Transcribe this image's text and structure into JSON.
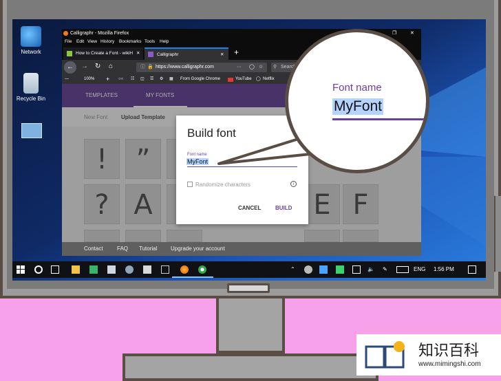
{
  "desktop": {
    "icons": [
      {
        "label": "Network"
      },
      {
        "label": "Recycle Bin"
      }
    ]
  },
  "firefox": {
    "window_title": "Calligraphr - Mozilla Firefox",
    "menu": [
      "File",
      "Edit",
      "View",
      "History",
      "Bookmarks",
      "Tools",
      "Help"
    ],
    "tabs": [
      {
        "label": "How to Create a Font - wikiH"
      },
      {
        "label": "Calligraphr"
      }
    ],
    "new_tab_symbol": "+",
    "url": "https://www.calligraphr.com",
    "url_more": "···",
    "search_placeholder": "Search",
    "zoom": "100%",
    "bookmarks": [
      "From Google Chrome",
      "YouTube",
      "Netflix"
    ]
  },
  "calligraphr": {
    "tabs": [
      "TEMPLATES",
      "MY FONTS"
    ],
    "sub_actions": [
      "New Font",
      "Upload Template"
    ],
    "glyphs_row1": [
      "!",
      "”"
    ],
    "glyphs_row2": [
      "?",
      "A"
    ],
    "glyphs_right": [
      "E",
      "F"
    ],
    "footer": [
      "Contact",
      "FAQ",
      "Tutorial",
      "Upgrade your account"
    ]
  },
  "dialog": {
    "title": "Build font",
    "field_label": "Font name",
    "field_value": "MyFont",
    "checkbox_label": "Randomize characters",
    "info_symbol": "i",
    "cancel": "CANCEL",
    "build": "BUILD"
  },
  "taskbar": {
    "language": "ENG",
    "time": "1:56 PM"
  },
  "magnifier": {
    "label": "Font name",
    "value": "MyFont"
  },
  "watermark": {
    "title": "知识百科",
    "url": "www.mimingshi.com"
  },
  "colors": {
    "accent": "#6b3fa0",
    "selection": "#b5d3ff",
    "monitor_border": "#5a4d45",
    "background": "#f7a1ea"
  }
}
